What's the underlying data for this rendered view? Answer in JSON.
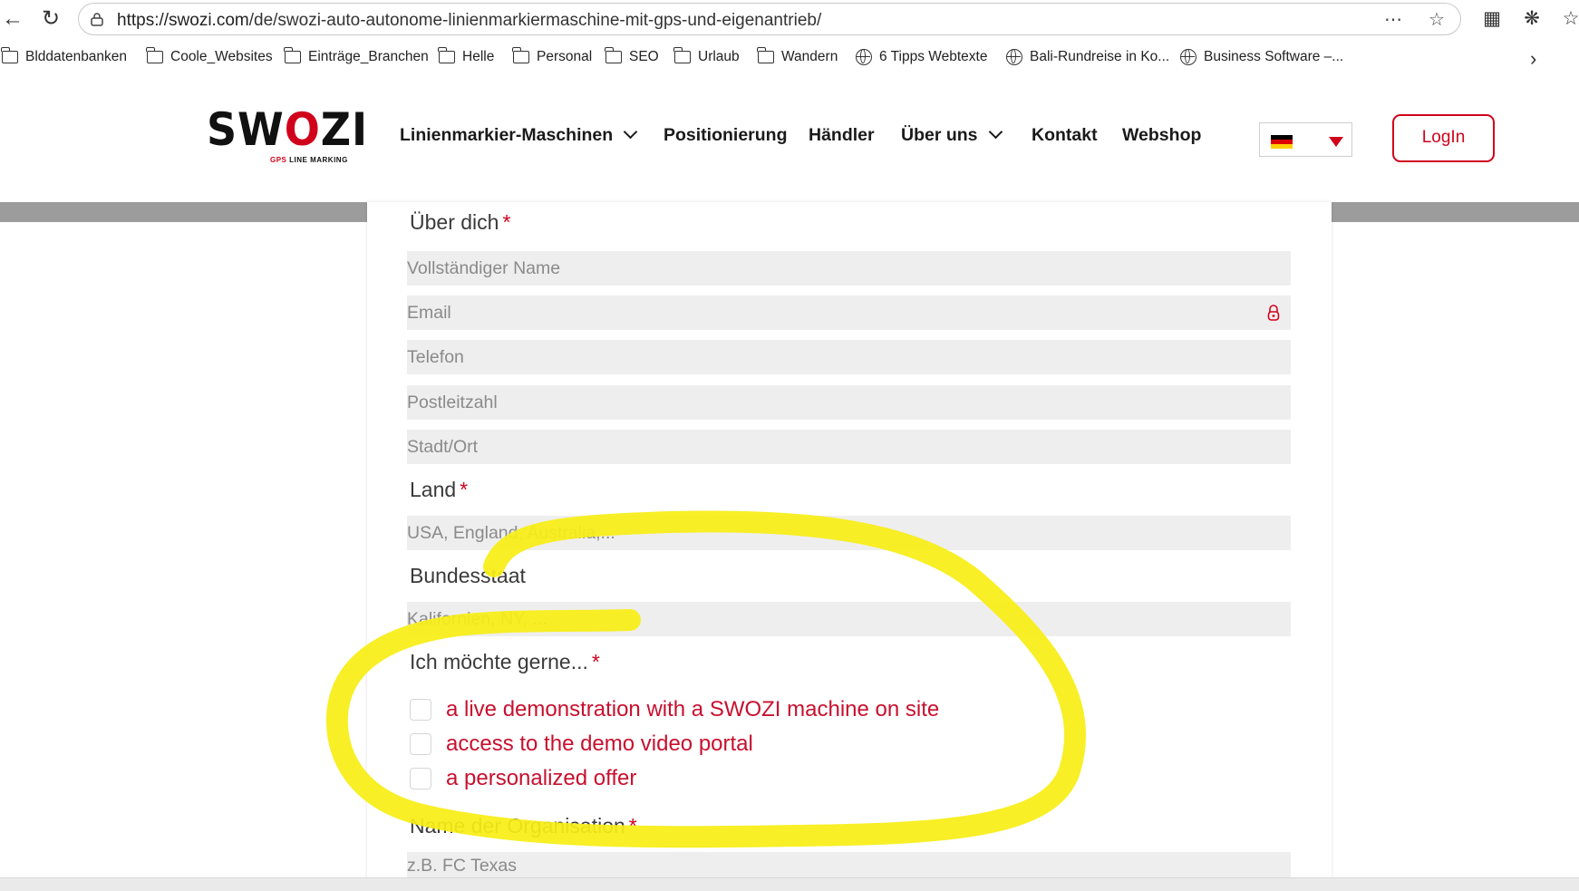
{
  "browser": {
    "url_host": "https://swozi.com",
    "url_path": "/de/swozi-auto-autonome-linienmarkiermaschine-mit-gps-und-eigenantrieb/",
    "bookmarks": [
      {
        "label": "Blddatenbanken",
        "icon": "folder-icon"
      },
      {
        "label": "Coole_Websites",
        "icon": "folder-icon"
      },
      {
        "label": "Einträge_Branchen",
        "icon": "folder-icon"
      },
      {
        "label": "Helle",
        "icon": "folder-icon"
      },
      {
        "label": "Personal",
        "icon": "folder-icon"
      },
      {
        "label": "SEO",
        "icon": "folder-icon"
      },
      {
        "label": "Urlaub",
        "icon": "folder-icon"
      },
      {
        "label": "Wandern",
        "icon": "folder-icon"
      },
      {
        "label": "6 Tipps Webtexte",
        "icon": "globe-icon"
      },
      {
        "label": "Bali-Rundreise in Ko...",
        "icon": "globe-icon"
      },
      {
        "label": "Business Software –...",
        "icon": "globe-icon"
      }
    ]
  },
  "header": {
    "logo_text_left": "SW",
    "logo_text_o": "O",
    "logo_text_right": "ZI",
    "logo_sub_red": "GPS",
    "logo_sub": "LINE MARKING",
    "nav": [
      {
        "label": "Linienmarkier-Maschinen",
        "dropdown": true
      },
      {
        "label": "Positionierung",
        "dropdown": false
      },
      {
        "label": "Händler",
        "dropdown": false
      },
      {
        "label": "Über uns",
        "dropdown": true
      },
      {
        "label": "Kontakt",
        "dropdown": false
      },
      {
        "label": "Webshop",
        "dropdown": false
      }
    ],
    "language_flag": "de-flag-icon",
    "login_label": "LogIn"
  },
  "colors": {
    "brand_red": "#d0021b",
    "option_red": "#c8102e",
    "highlight_yellow": "#f7ee16"
  },
  "form": {
    "about_label": "Über dich",
    "name_placeholder": "Vollständiger Name",
    "email_placeholder": "Email",
    "phone_placeholder": "Telefon",
    "zip_placeholder": "Postleitzahl",
    "city_placeholder": "Stadt/Ort",
    "country_label": "Land",
    "country_placeholder": "USA, England, Australia,...",
    "state_label": "Bundesstaat",
    "state_placeholder": "Kalifornien, NY, ...",
    "wish_label": "Ich möchte gerne...",
    "options": [
      {
        "label": "a live demonstration with a SWOZI machine on site",
        "checked": false
      },
      {
        "label": "access to the demo video portal",
        "checked": false
      },
      {
        "label": "a personalized offer",
        "checked": false
      }
    ],
    "org_label": "Name der Organisation",
    "org_placeholder": "z.B. FC Texas",
    "required_mark": "*"
  }
}
